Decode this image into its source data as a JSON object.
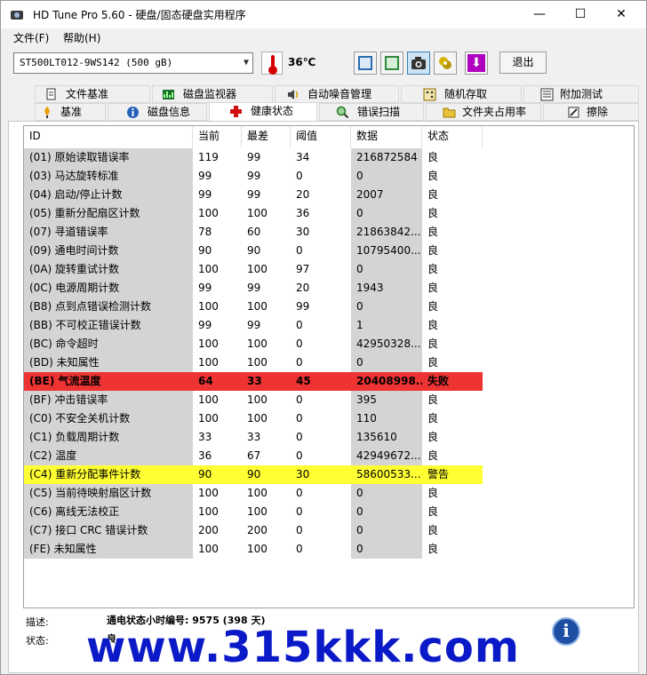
{
  "window": {
    "title": "HD Tune Pro 5.60 - 硬盘/固态硬盘实用程序",
    "min": "—",
    "max": "☐",
    "close": "✕"
  },
  "menu": {
    "file": "文件(F)",
    "help": "帮助(H)"
  },
  "toolbar": {
    "drive": "ST500LT012-9WS142 (500 gB)",
    "temperature": "36℃",
    "exit_label": "退出",
    "icons": [
      "copy-text-icon",
      "copy-screen-icon",
      "camera-icon",
      "tools-icon",
      "download-icon"
    ]
  },
  "tabs_top": [
    {
      "label": "文件基准",
      "icon": "file-benchmark-icon"
    },
    {
      "label": "磁盘监视器",
      "icon": "disk-monitor-icon"
    },
    {
      "label": "自动噪音管理",
      "icon": "speaker-icon"
    },
    {
      "label": "随机存取",
      "icon": "random-access-icon"
    },
    {
      "label": "附加测试",
      "icon": "extra-tests-icon"
    }
  ],
  "tabs_bottom": [
    {
      "label": "基准",
      "icon": "benchmark-icon"
    },
    {
      "label": "磁盘信息",
      "icon": "info-icon"
    },
    {
      "label": "健康状态",
      "icon": "health-cross-icon"
    },
    {
      "label": "错误扫描",
      "icon": "magnifier-icon"
    },
    {
      "label": "文件夹占用率",
      "icon": "folder-icon"
    },
    {
      "label": "擦除",
      "icon": "erase-icon"
    }
  ],
  "grid": {
    "headers": {
      "id": "ID",
      "current": "当前",
      "worst": "最差",
      "threshold": "阈值",
      "data": "数据",
      "status": "状态"
    },
    "rows": [
      {
        "id": "(01) 原始读取错误率",
        "current": "119",
        "worst": "99",
        "threshold": "34",
        "data": "216872584",
        "status": "良"
      },
      {
        "id": "(03) 马达旋转标准",
        "current": "99",
        "worst": "99",
        "threshold": "0",
        "data": "0",
        "status": "良"
      },
      {
        "id": "(04) 启动/停止计数",
        "current": "99",
        "worst": "99",
        "threshold": "20",
        "data": "2007",
        "status": "良"
      },
      {
        "id": "(05) 重新分配扇区计数",
        "current": "100",
        "worst": "100",
        "threshold": "36",
        "data": "0",
        "status": "良"
      },
      {
        "id": "(07) 寻道错误率",
        "current": "78",
        "worst": "60",
        "threshold": "30",
        "data": "21863842...",
        "status": "良"
      },
      {
        "id": "(09) 通电时间计数",
        "current": "90",
        "worst": "90",
        "threshold": "0",
        "data": "10795400...",
        "status": "良"
      },
      {
        "id": "(0A) 旋转重试计数",
        "current": "100",
        "worst": "100",
        "threshold": "97",
        "data": "0",
        "status": "良"
      },
      {
        "id": "(0C) 电源周期计数",
        "current": "99",
        "worst": "99",
        "threshold": "20",
        "data": "1943",
        "status": "良"
      },
      {
        "id": "(B8) 点到点错误检测计数",
        "current": "100",
        "worst": "100",
        "threshold": "99",
        "data": "0",
        "status": "良"
      },
      {
        "id": "(BB) 不可校正错误计数",
        "current": "99",
        "worst": "99",
        "threshold": "0",
        "data": "1",
        "status": "良"
      },
      {
        "id": "(BC) 命令超时",
        "current": "100",
        "worst": "100",
        "threshold": "0",
        "data": "42950328...",
        "status": "良"
      },
      {
        "id": "(BD) 未知属性",
        "current": "100",
        "worst": "100",
        "threshold": "0",
        "data": "0",
        "status": "良"
      },
      {
        "id": "(BE) 气流温度",
        "current": "64",
        "worst": "33",
        "threshold": "45",
        "data": "20408998...",
        "status": "失败",
        "highlight": "#ee3333"
      },
      {
        "id": "(BF) 冲击错误率",
        "current": "100",
        "worst": "100",
        "threshold": "0",
        "data": "395",
        "status": "良"
      },
      {
        "id": "(C0) 不安全关机计数",
        "current": "100",
        "worst": "100",
        "threshold": "0",
        "data": "110",
        "status": "良"
      },
      {
        "id": "(C1) 负载周期计数",
        "current": "33",
        "worst": "33",
        "threshold": "0",
        "data": "135610",
        "status": "良"
      },
      {
        "id": "(C2) 温度",
        "current": "36",
        "worst": "67",
        "threshold": "0",
        "data": "42949672...",
        "status": "良"
      },
      {
        "id": "(C4) 重新分配事件计数",
        "current": "90",
        "worst": "90",
        "threshold": "30",
        "data": "58600533...",
        "status": "警告",
        "highlight": "#ffff33"
      },
      {
        "id": "(C5) 当前待映射扇区计数",
        "current": "100",
        "worst": "100",
        "threshold": "0",
        "data": "0",
        "status": "良"
      },
      {
        "id": "(C6) 离线无法校正",
        "current": "100",
        "worst": "100",
        "threshold": "0",
        "data": "0",
        "status": "良"
      },
      {
        "id": "(C7) 接口 CRC 错误计数",
        "current": "200",
        "worst": "200",
        "threshold": "0",
        "data": "0",
        "status": "良"
      },
      {
        "id": "(FE) 未知属性",
        "current": "100",
        "worst": "100",
        "threshold": "0",
        "data": "0",
        "status": "良"
      }
    ]
  },
  "footer": {
    "desc_label": "描述:",
    "desc_value": "通电状态小时编号: 9575 (398 天)",
    "status_label": "状态:",
    "status_value": "良",
    "info_label": "i"
  },
  "watermark": "www.315kkk.com"
}
